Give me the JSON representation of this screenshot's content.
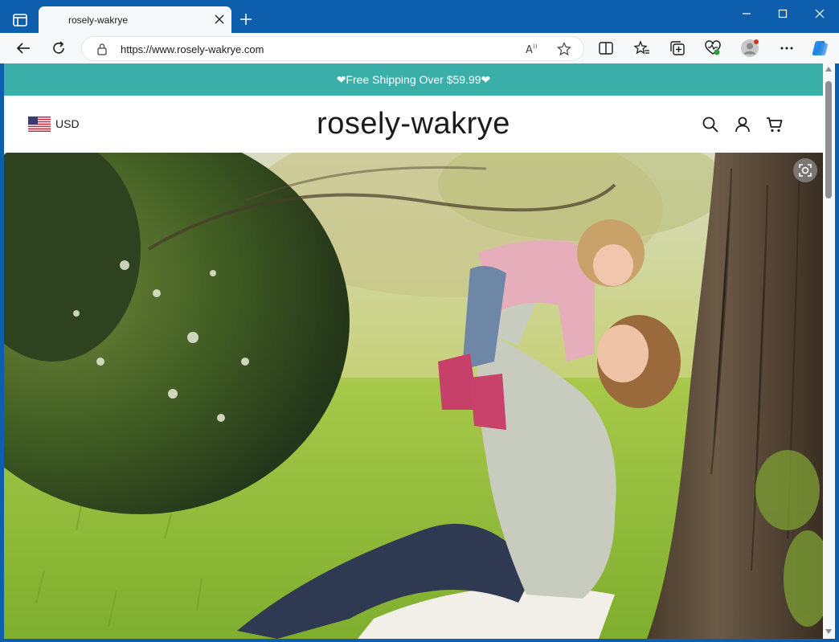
{
  "browser": {
    "tab_title": "rosely-wakrye",
    "url": "https://www.rosely-wakrye.com"
  },
  "store": {
    "announcement": "❤Free Shipping Over $59.99❤",
    "currency": "USD",
    "brand_name": "rosely-wakrye"
  },
  "icons": {
    "tab_actions": "tab-actions-icon",
    "close": "close-icon",
    "new_tab": "plus-icon",
    "back": "back-arrow-icon",
    "refresh": "refresh-icon",
    "lock": "lock-icon",
    "read_aloud": "read-aloud-icon",
    "favorite": "star-icon",
    "split_screen": "split-screen-icon",
    "favorites": "favorites-icon",
    "collections": "collections-icon",
    "browser_essentials": "heart-pulse-icon",
    "profile": "profile-avatar",
    "more": "more-dots-icon",
    "copilot": "copilot-icon",
    "search": "search-icon",
    "account": "account-icon",
    "cart": "cart-icon",
    "visual_search": "visual-search-icon"
  },
  "colors": {
    "announcement_bg": "#3aafa9",
    "titlebar": "#0d5fae",
    "toolbar": "#f7f8fa"
  }
}
